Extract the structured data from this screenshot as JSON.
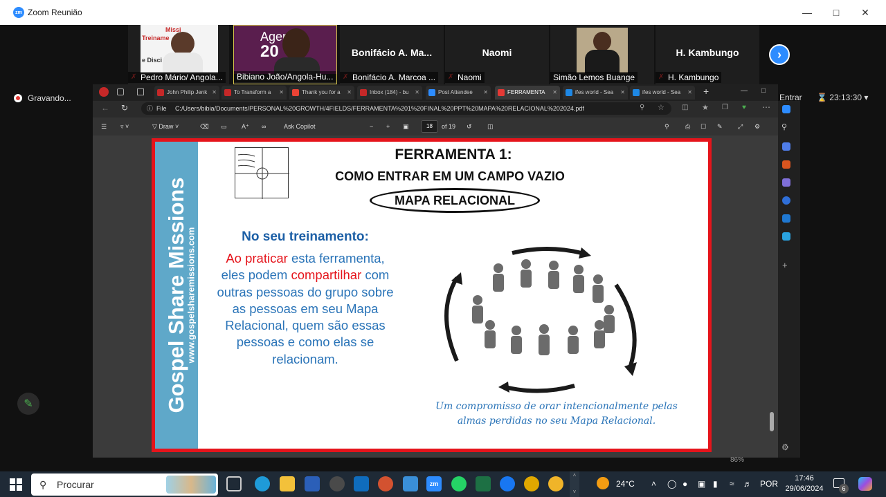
{
  "window": {
    "title": "Zoom Reunião",
    "app_logo": "zm"
  },
  "participants": [
    {
      "name": "Pedro Mário/ Angola...",
      "video": true,
      "muted": true,
      "slide_text": "Treiname",
      "slide_text2": "Missi",
      "slide_text3": "e Disci"
    },
    {
      "name": "Bibiano João/Angola-Hu...",
      "video": true,
      "muted": true,
      "active": true,
      "bg_text": "Agen",
      "bg_text2": "20"
    },
    {
      "name": "Bonifácio A. Marcoa ...",
      "display": "Bonifácio  A.  Ma...",
      "video": false,
      "muted": true
    },
    {
      "name": "Naomi",
      "display": "Naomi",
      "video": false,
      "muted": true
    },
    {
      "name": "Simão Lemos Buange",
      "video": true,
      "muted": false
    },
    {
      "name": "H. Kambungo",
      "display": "H. Kambungo",
      "video": false,
      "muted": true
    }
  ],
  "recording": {
    "label": "Gravando..."
  },
  "meeting": {
    "enter_label": "Entrar",
    "timer": "23:13:30"
  },
  "browser": {
    "tabs": [
      {
        "label": "John Philip Jenk",
        "color": "#c62828"
      },
      {
        "label": "To Transform a",
        "color": "#c62828"
      },
      {
        "label": "Thank you for a",
        "color": "#ea4335"
      },
      {
        "label": "Inbox (184) - bu",
        "color": "#c62828"
      },
      {
        "label": "Post Attendee",
        "color": "#2d8cff"
      },
      {
        "label": "FERRAMENTA",
        "color": "#e53935",
        "active": true
      },
      {
        "label": "ifes world - Sea",
        "color": "#1e88e5"
      },
      {
        "label": "ifes world - Sea",
        "color": "#1e88e5"
      }
    ],
    "address_scheme": "File",
    "address": "C:/Users/bibia/Documents/PERSONAL%20GROWTH/4FIELDS/FERRAMENTA%201%20FINAL%20PPT%20MAPA%20RELACIONAL%202024.pdf",
    "pdf_toolbar": {
      "draw": "Draw",
      "ask": "Ask Copilot",
      "page": "18",
      "of": "of 19",
      "zoom": "86%"
    }
  },
  "slide": {
    "banner_title": "Gospel Share Missions",
    "banner_url": "www.gospelsharemissions.com",
    "title1": "FERRAMENTA 1:",
    "title2": "COMO ENTRAR EM UM CAMPO VAZIO",
    "oval": "MAPA RELACIONAL",
    "training_heading": "No seu treinamento:",
    "para_red1": "Ao praticar",
    "para_1": " esta ferramenta, eles podem ",
    "para_red2": "compartilhar",
    "para_2": " com outras pessoas do grupo sobre as pessoas em seu Mapa Relacional, quem são essas pessoas e como elas se relacionam.",
    "caption": "Um compromisso de orar intencionalmente pelas almas perdidas no seu Mapa Relacional."
  },
  "taskbar": {
    "search_placeholder": "Procurar",
    "weather": "24°C",
    "language": "POR",
    "time": "17:46",
    "date": "29/06/2024",
    "notifications": "6"
  }
}
